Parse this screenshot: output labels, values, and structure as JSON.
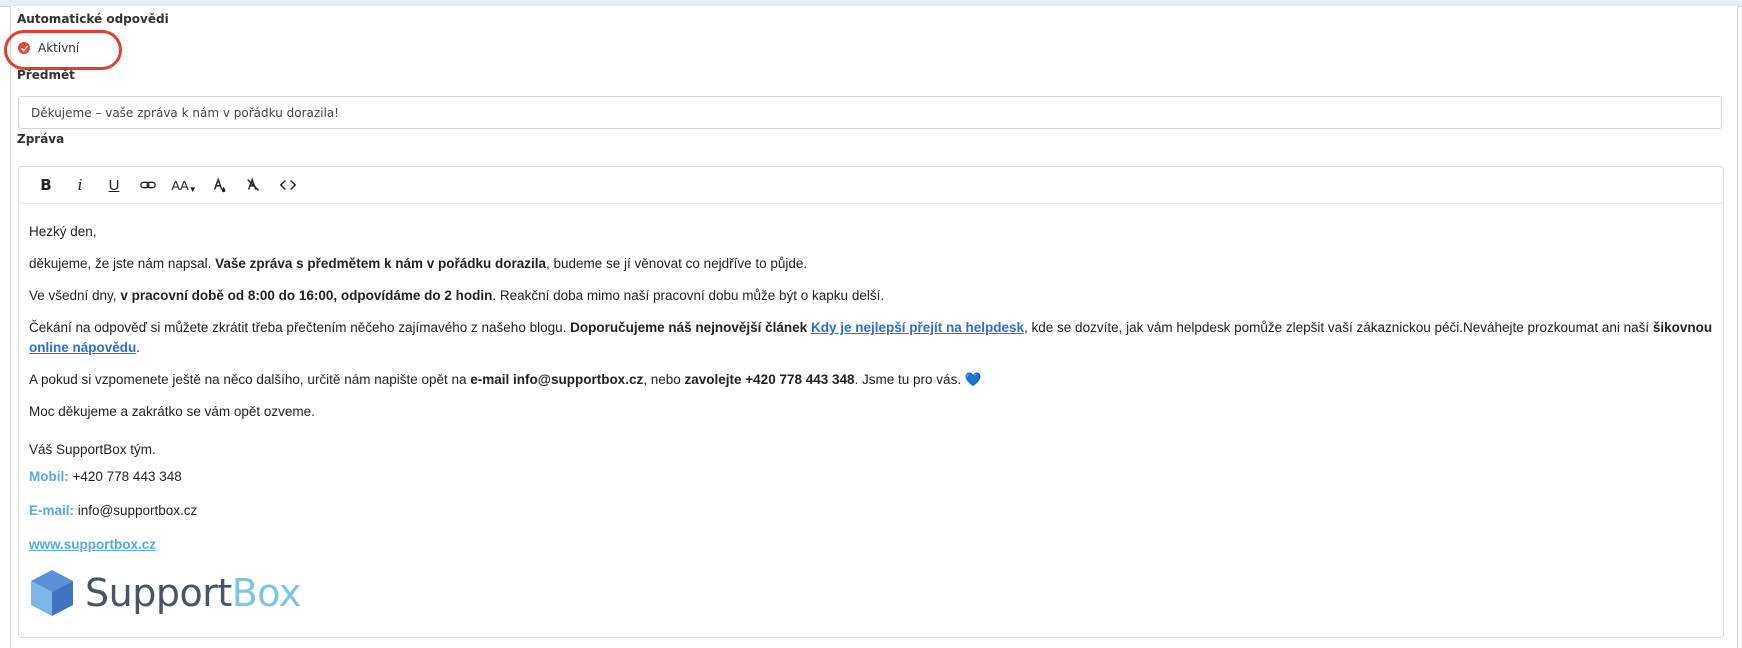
{
  "form": {
    "auto_reply_label": "Automatické odpovědi",
    "active_label": "Aktivní",
    "active_checked": true,
    "subject_label": "Předmět",
    "subject_value": "Děkujeme – vaše zpráva k nám v pořádku dorazila!",
    "message_label": "Zpráva"
  },
  "toolbar": {
    "bold": "B",
    "italic": "i",
    "underline": "U",
    "font_size": "AA",
    "code": "<>",
    "icons": [
      "bold-icon",
      "italic-icon",
      "underline-icon",
      "link-icon",
      "font-size-icon",
      "text-color-icon",
      "clear-format-icon",
      "code-view-icon"
    ]
  },
  "message": {
    "greeting": "Hezký den,",
    "p1_a": "děkujeme, že jste nám napsal. ",
    "p1_b": "Vaše zpráva s předmětem k nám v pořádku dorazila",
    "p1_c": ", budeme se jí věnovat co nejdříve to půjde.",
    "p2_a": "Ve všední dny, ",
    "p2_b": "v pracovní době od 8:00 do 16:00, odpovídáme do 2 hodin",
    "p2_c": ". Reakční doba mimo naší pracovní dobu může být o kapku delší.",
    "p3_a": "Čekání na odpověď si můžete zkrátit třeba přečtením něčeho zajímavého z našeho blogu. ",
    "p3_b": "Doporučujeme náš nejnovější článek ",
    "p3_link": "Kdy je nejlepší přejít na helpdesk",
    "p3_c": ", kde se dozvíte, jak vám helpdesk pomůže zlepšit vaší zákaznickou péči.Neváhejte prozkoumat ani naší ",
    "p3_d": "šikovnou ",
    "p3_link2": "online nápovědu",
    "p3_e": ".",
    "p4_a": "A pokud si vzpomenete ještě na něco dalšího, určitě nám napište opět na ",
    "p4_b": "e-mail info@supportbox.cz",
    "p4_c": ", nebo ",
    "p4_d": "zavolejte +420 778 443 348",
    "p4_e": ". Jsme tu pro vás. ",
    "p4_heart": "💙",
    "p5": "Moc děkujeme a zakrátko se vám opět ozveme.",
    "sign": "Váš SupportBox tým.",
    "mobile_label": "Mobil:",
    "mobile_value": " +420 778 443 348",
    "email_label": "E-mail:",
    "email_value": " info@supportbox.cz",
    "web": "www.supportbox.cz",
    "logo_support": "Support",
    "logo_box": "Box"
  },
  "colors": {
    "accent_red": "#e2402f",
    "link_blue": "#2a6ed8",
    "signature_blue": "#56a9e3",
    "logo_gray": "#4a5563",
    "logo_light_blue": "#7fc3ea"
  }
}
